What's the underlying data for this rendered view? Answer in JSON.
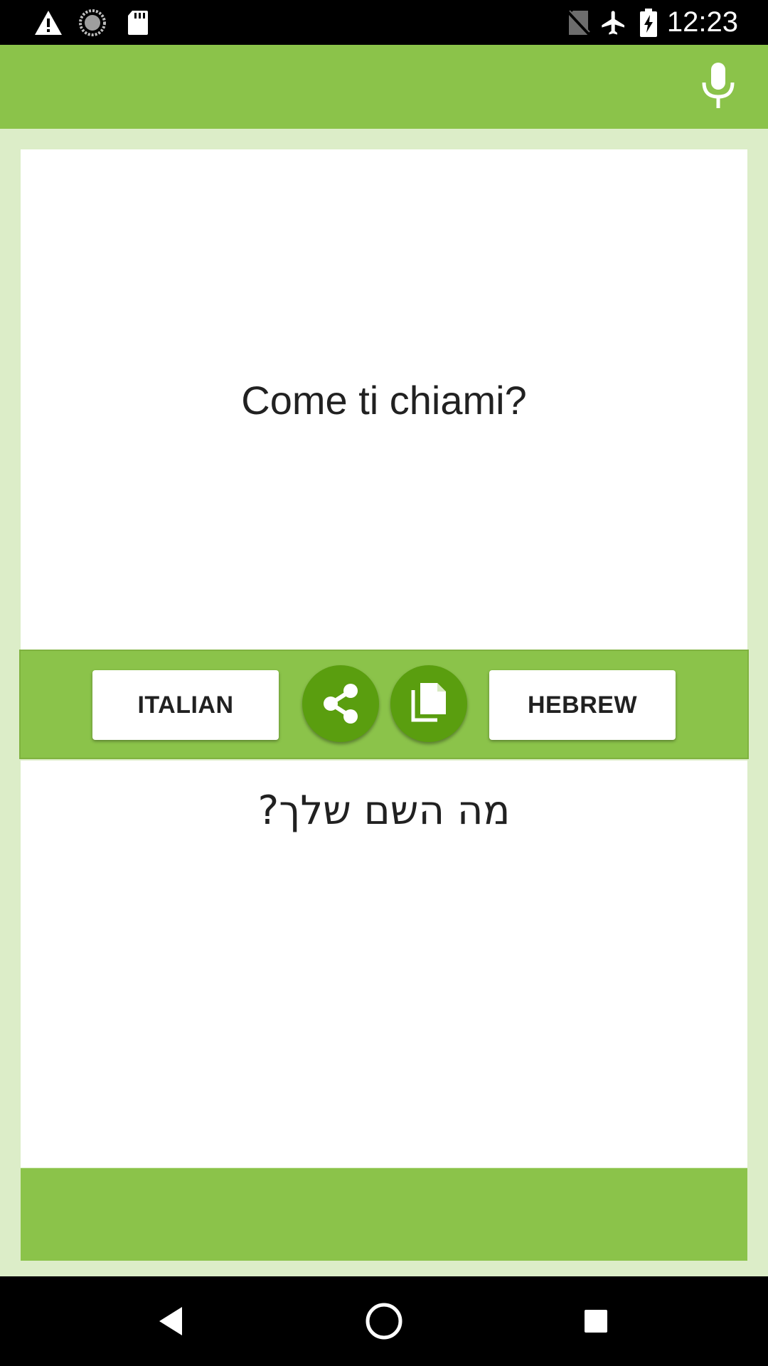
{
  "status_bar": {
    "time": "12:23",
    "icons_left": [
      "warning-icon",
      "sync-icon",
      "sd-card-icon"
    ],
    "icons_right": [
      "no-sim-icon",
      "airplane-mode-icon",
      "battery-charging-icon"
    ]
  },
  "toolbar": {
    "mic_icon": "microphone-icon"
  },
  "translation": {
    "source_text": "Come ti chiami?",
    "target_text": "מה השם שלך?"
  },
  "language_bar": {
    "source_language": "ITALIAN",
    "target_language": "HEBREW",
    "share_icon": "share-icon",
    "copy_icon": "copy-icon"
  },
  "nav_bar": {
    "back_icon": "back-icon",
    "home_icon": "home-icon",
    "recents_icon": "recents-icon"
  },
  "colors": {
    "primary": "#8bc34a",
    "background": "#dcedc8",
    "accent_dark": "#5a9e0f"
  }
}
